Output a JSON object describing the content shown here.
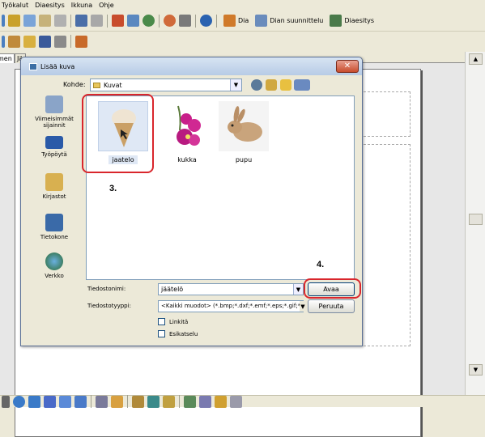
{
  "menu": [
    "Työkalut",
    "Diaesitys",
    "Ikkuna",
    "Ohje"
  ],
  "toolbar": {
    "dia_label": "Dia",
    "dian_suunnittelu_label": "Dian suunnittelu",
    "diaesitys_label": "Diaesitys"
  },
  "tabs": [
    "men",
    "Jä"
  ],
  "dialog": {
    "title": "Lisää kuva",
    "close": "✕",
    "kohde_label": "Kohde:",
    "kohde_value": "Kuvat",
    "places": [
      "Viimeisimmät sijainnit",
      "Työpöytä",
      "Kirjastot",
      "Tietokone",
      "Verkko"
    ],
    "files": [
      "jaatelo",
      "kukka",
      "pupu"
    ],
    "filename_label": "Tiedostonimi:",
    "filename_value": "jäätelö",
    "filetype_label": "Tiedostotyyppi:",
    "filetype_value": "<Kaikki muodot> (*.bmp;*.dxf;*.emf;*.eps;*.gif;*.jpg",
    "open_button": "Avaa",
    "cancel_button": "Peruuta",
    "link_label": "Linkitä",
    "preview_label": "Esikatselu"
  },
  "annotations": {
    "step3": "3.",
    "step4": "4."
  },
  "colors": {
    "annotation_red": "#d9262c",
    "selection": "#dfe8f5"
  }
}
